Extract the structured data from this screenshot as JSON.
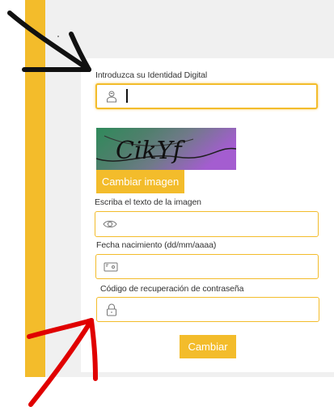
{
  "form": {
    "identity_label": "Introduzca su Identidad Digital",
    "identity_value": "",
    "captcha_text": "CikYf",
    "change_image_label": "Cambiar imagen",
    "captcha_input_label": "Escriba el texto de la imagen",
    "captcha_value": "",
    "birth_label": "Fecha nacimiento (dd/mm/aaaa)",
    "birth_value": "",
    "recovery_label": "Código de recuperación de contraseña",
    "recovery_value": "",
    "submit_label": "Cambiar"
  },
  "icons": {
    "identity": "user-icon",
    "captcha": "eye-icon",
    "birth": "id-card-icon",
    "recovery": "lock-icon"
  },
  "colors": {
    "accent": "#f3bc2b",
    "annotation_black": "#111111",
    "annotation_red": "#e00000"
  }
}
